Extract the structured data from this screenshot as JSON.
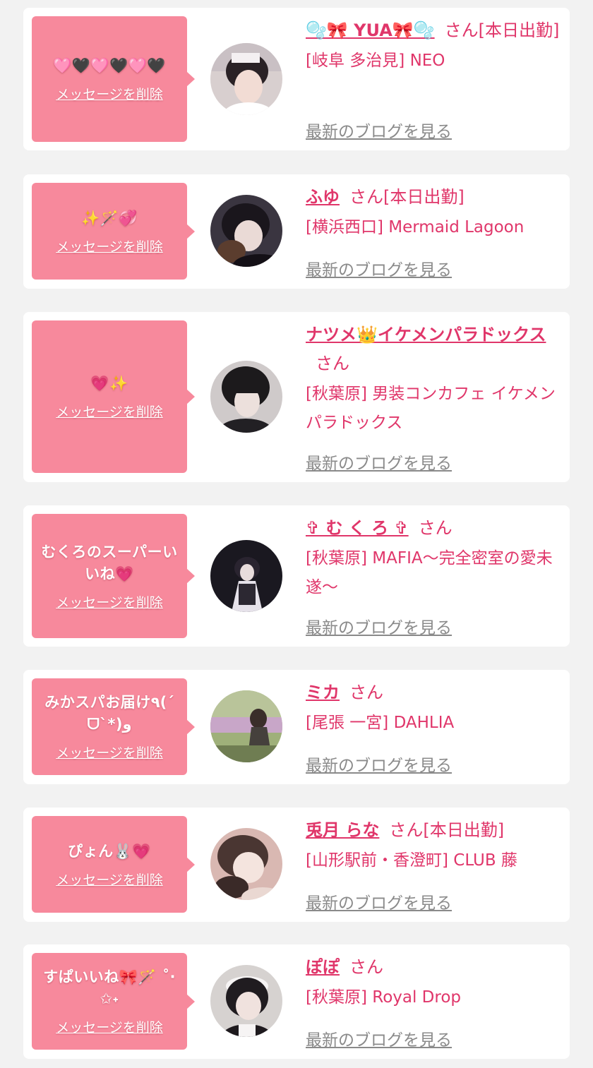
{
  "common": {
    "delete_label": "メッセージを削除",
    "blog_label": "最新のブログを見る",
    "accent_pink": "#e0366a",
    "bubble_pink": "#f7899c"
  },
  "cards": [
    {
      "message": "🩷🖤🩷🖤🩷🖤",
      "name": "🫧🎀 YUA🎀🫧",
      "suffix": "さん[本日出勤]",
      "shop": "[岐阜 多治見] NEO",
      "avatar_icon": "cast-photo-icon"
    },
    {
      "message": "✨🪄💞",
      "name": "ふゆ",
      "suffix": "さん[本日出勤]",
      "shop": "[横浜西口] Mermaid Lagoon",
      "avatar_icon": "cast-photo-icon"
    },
    {
      "message": "💗✨",
      "name": "ナツメ👑イケメンパラドックス",
      "suffix": "さん",
      "shop": "[秋葉原] 男装コンカフェ イケメンパラドックス",
      "avatar_icon": "cast-photo-icon"
    },
    {
      "message": "むくろのスーパーいいね💗",
      "name": "✞ む く ろ ✞",
      "suffix": "さん",
      "shop": "[秋葉原] MAFIA〜完全密室の愛未遂〜",
      "avatar_icon": "cast-photo-icon"
    },
    {
      "message": "みかスパお届け٩(ˊᗜˋ*)و",
      "name": "ミカ",
      "suffix": "さん",
      "shop": "[尾張 一宮] DAHLIA",
      "avatar_icon": "cast-photo-icon"
    },
    {
      "message": "ぴょん🐰💗",
      "name": "兎月 らな",
      "suffix": "さん[本日出勤]",
      "shop": "[山形駅前・香澄町] CLUB 藤",
      "avatar_icon": "cast-photo-icon"
    },
    {
      "message": "すぱいいね🎀🪄 ˚‧✩˖",
      "name": "ぽぽ",
      "suffix": "さん",
      "shop": "[秋葉原] Royal Drop",
      "avatar_icon": "cast-photo-icon"
    }
  ]
}
